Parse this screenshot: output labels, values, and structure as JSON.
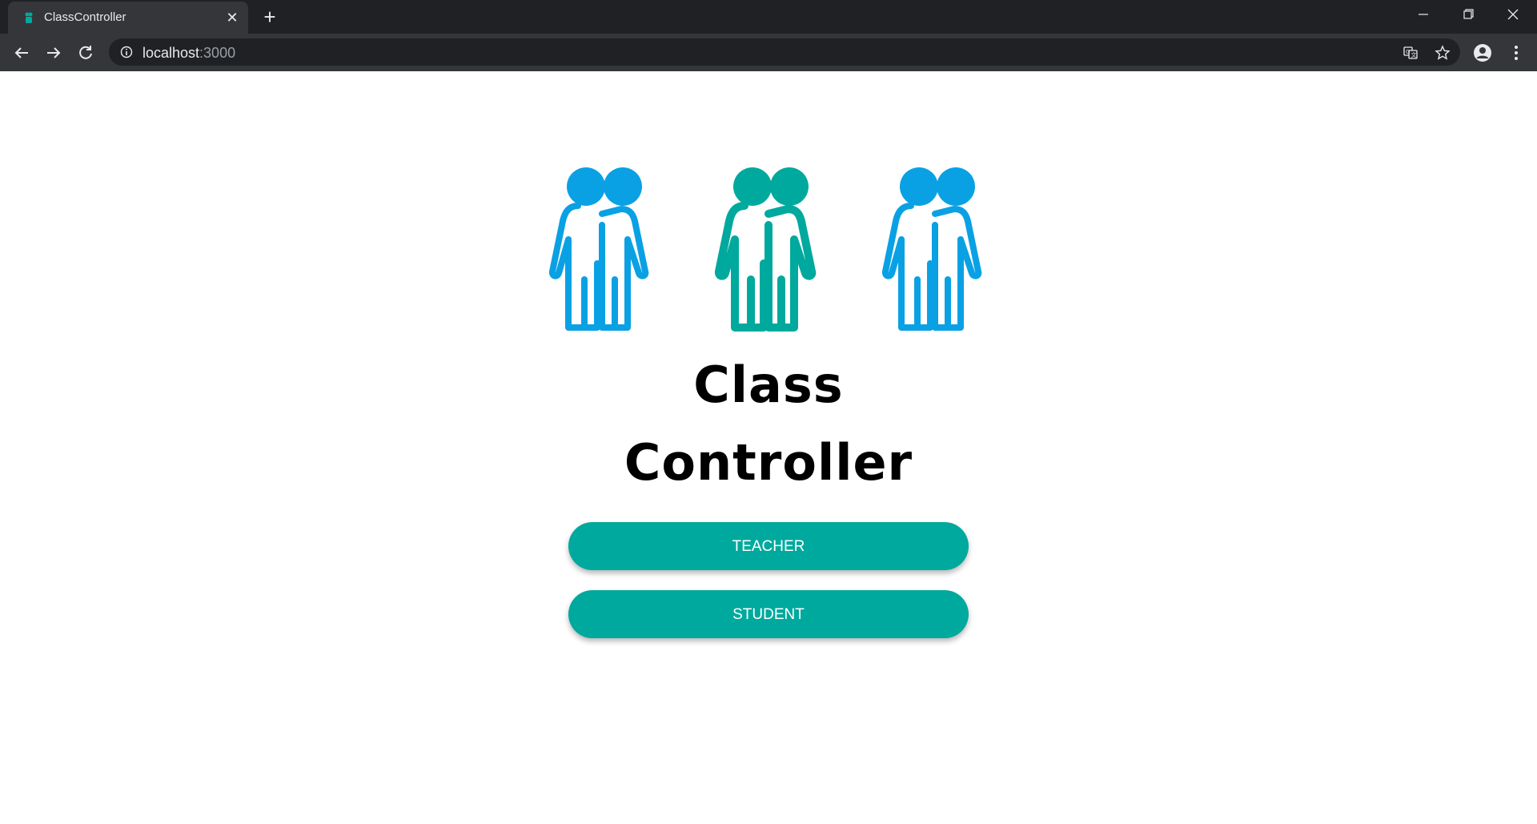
{
  "browser": {
    "tab_title": "ClassController",
    "url_host": "localhost",
    "url_port": ":3000"
  },
  "page": {
    "title_line1": "Class",
    "title_line2": "Controller",
    "teacher_button": "TEACHER",
    "student_button": "STUDENT"
  },
  "colors": {
    "accent": "#00a99d",
    "figure_blue": "#0aa1e4",
    "figure_teal": "#00a99d"
  },
  "icons": {
    "figures": [
      "two-people-icon",
      "two-people-icon",
      "two-people-icon"
    ]
  }
}
